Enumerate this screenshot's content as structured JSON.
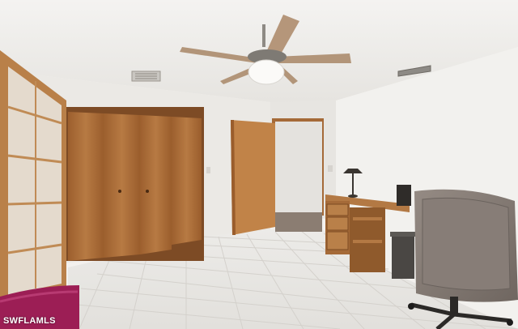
{
  "watermark": {
    "text": "SWFLAMLS"
  },
  "colors": {
    "ceiling": "#f1f0ee",
    "wall": "#eceae6",
    "floor_tile": "#e9e7e3",
    "wood": "#b0743e",
    "wood_dark": "#8a5428",
    "chair": "#8a807a"
  }
}
